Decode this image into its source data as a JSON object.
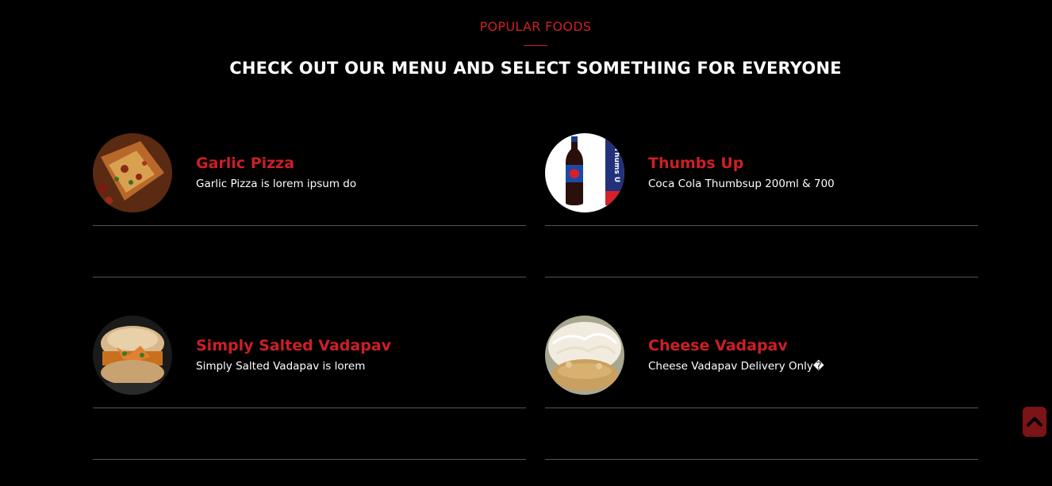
{
  "section": {
    "eyebrow": "POPULAR FOODS",
    "headline": "CHECK OUT OUR MENU AND SELECT SOMETHING FOR EVERYONE"
  },
  "menu_items": [
    {
      "title": "Garlic Pizza",
      "description": "Garlic Pizza is lorem ipsum do",
      "image": "garlic-pizza-photo"
    },
    {
      "title": "Thumbs Up",
      "description": "Coca Cola Thumbsup 200ml & 700",
      "image": "thumbs-up-bottle-photo"
    },
    {
      "title": "Simply Salted Vadapav",
      "description": "Simply Salted Vadapav is lorem",
      "image": "vadapav-photo"
    },
    {
      "title": "Cheese Vadapav",
      "description": "Cheese Vadapav Delivery Only�",
      "image": "cheese-vadapav-photo"
    }
  ],
  "colors": {
    "background": "#000000",
    "accent": "#cc1f25",
    "text": "#ffffff",
    "divider": "#555555",
    "scroll_button": "#7a1417"
  },
  "scroll_top": {
    "icon": "chevron-up-icon"
  }
}
